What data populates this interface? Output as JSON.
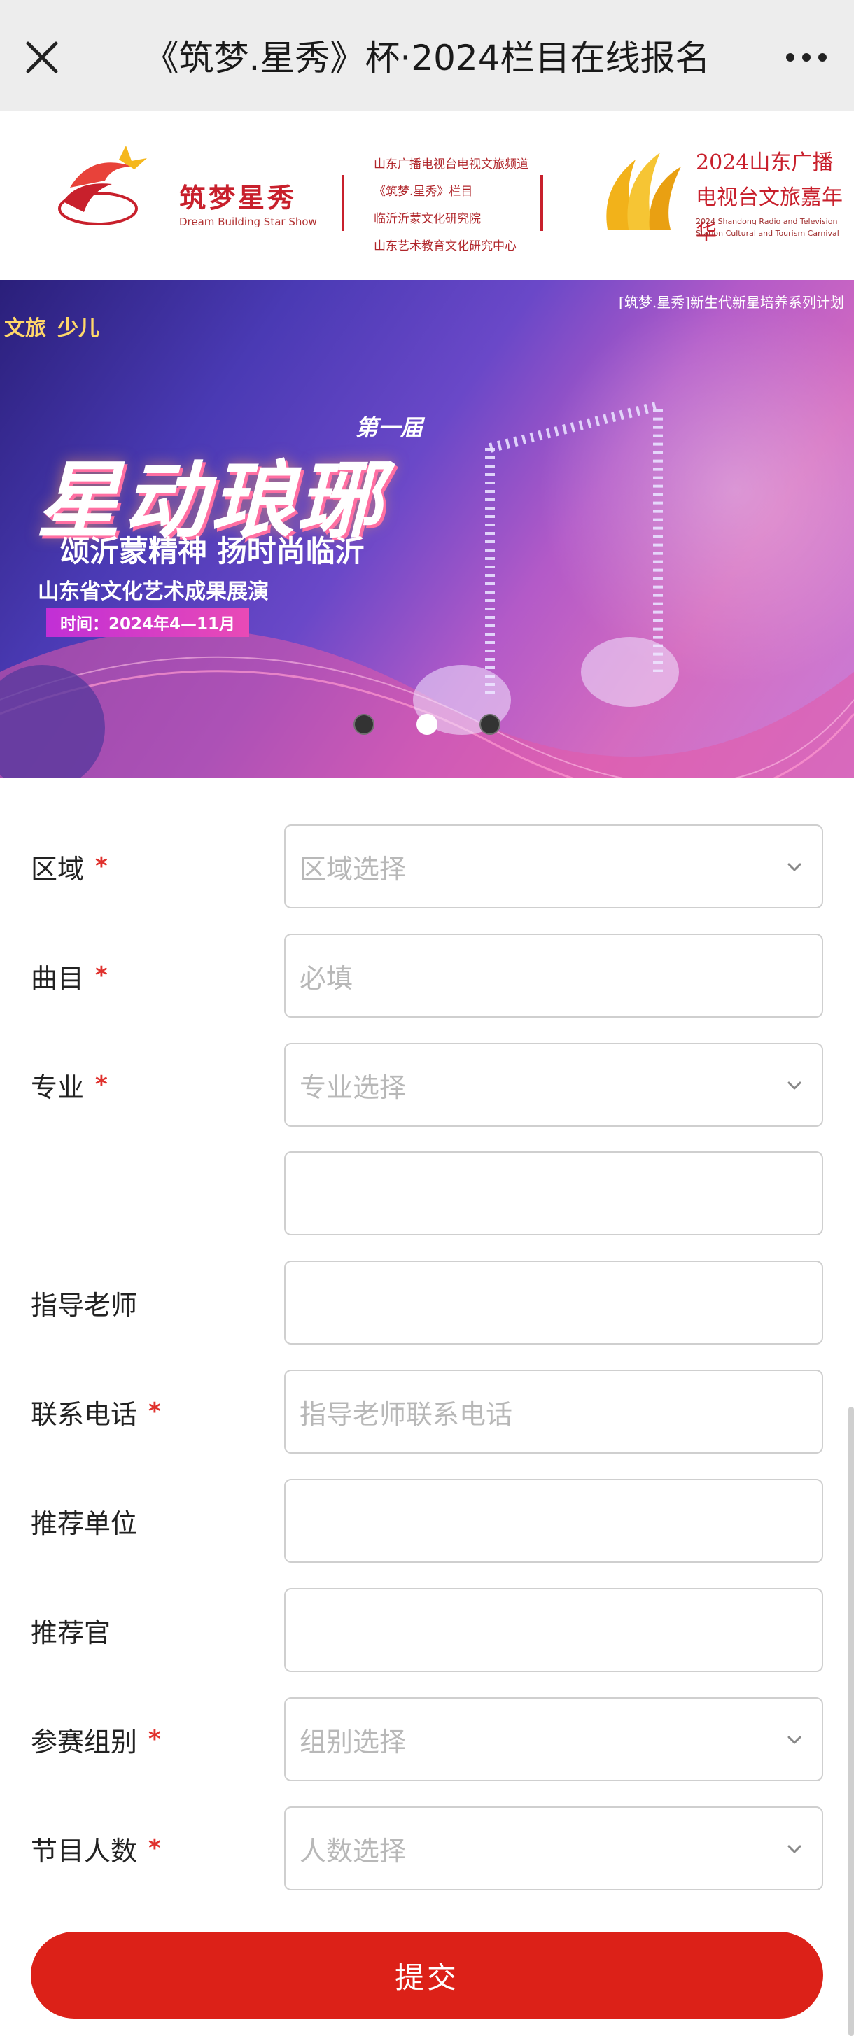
{
  "navbar": {
    "title": "《筑梦.星秀》杯·2024栏目在线报名",
    "close_icon": "close-icon",
    "more_icon": "more-dots-icon"
  },
  "header": {
    "left_logo_title": "筑梦星秀",
    "left_logo_subtitle": "Dream Building Star Show",
    "organizations": [
      "山东广播电视台电视文旅频道",
      "《筑梦.星秀》栏目",
      "临沂沂蒙文化研究院",
      "山东艺术教育文化研究中心"
    ],
    "right_logo_title": "2024山东广播电视台文旅嘉年华",
    "right_logo_subtitle": "2024 Shandong Radio and Television Station Cultural and Tourism Carnival"
  },
  "banner": {
    "top_label": "[筑梦.星秀]新生代新星培养系列计划",
    "brand_1": "文旅",
    "brand_2": "少儿",
    "edition": "第一届",
    "headline": "星动琅琊",
    "slogan": "颂沂蒙精神  扬时尚临沂",
    "event": "山东省文化艺术成果展演",
    "date": "时间：2024年4—11月",
    "active_slide": 2,
    "slide_count": 3
  },
  "form": {
    "fields": [
      {
        "label": "区域",
        "required": true,
        "type": "select",
        "placeholder": "区域选择"
      },
      {
        "label": "曲目",
        "required": true,
        "type": "text",
        "placeholder": "必填"
      },
      {
        "label": "专业",
        "required": true,
        "type": "select",
        "placeholder": "专业选择"
      },
      {
        "label": "",
        "required": false,
        "type": "text",
        "placeholder": ""
      },
      {
        "label": "指导老师",
        "required": false,
        "type": "text",
        "placeholder": ""
      },
      {
        "label": "联系电话",
        "required": true,
        "type": "text",
        "placeholder": "指导老师联系电话"
      },
      {
        "label": "推荐单位",
        "required": false,
        "type": "text",
        "placeholder": ""
      },
      {
        "label": "推荐官",
        "required": false,
        "type": "text",
        "placeholder": ""
      },
      {
        "label": "参赛组别",
        "required": true,
        "type": "select",
        "placeholder": "组别选择"
      },
      {
        "label": "节目人数",
        "required": true,
        "type": "select",
        "placeholder": "人数选择"
      }
    ],
    "required_mark": "*",
    "submit_label": "提交"
  },
  "colors": {
    "accent_red": "#dc2118",
    "required_red": "#e0312d",
    "navbar_bg": "#ededed"
  }
}
